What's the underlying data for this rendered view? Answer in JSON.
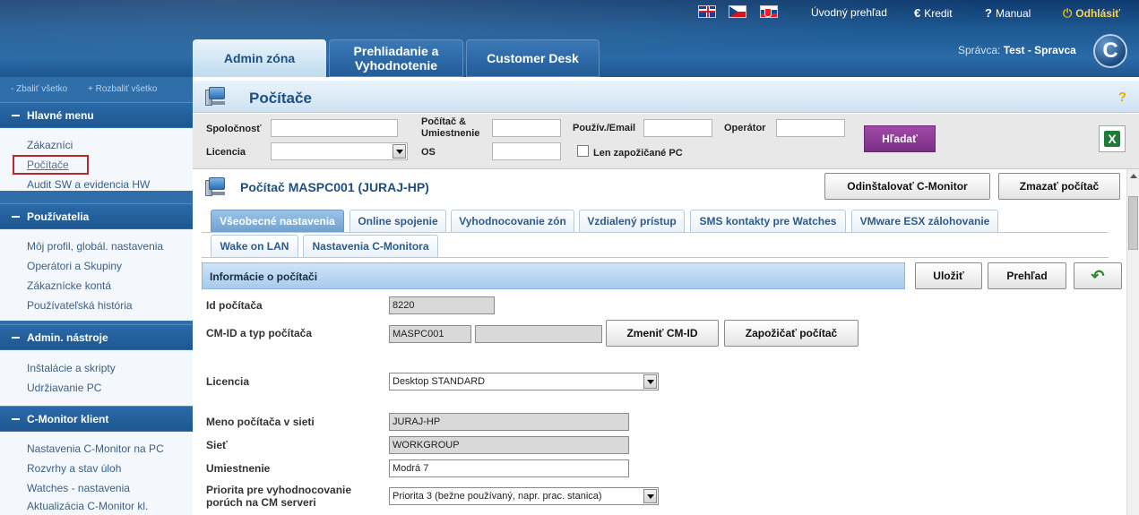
{
  "header": {
    "links": {
      "home": "Úvodný prehľad",
      "credit": "Kredit",
      "manual": "Manual",
      "logout": "Odhlásiť"
    },
    "tabs": {
      "admin": "Admin zóna",
      "browse": "Prehliadanie a Vyhodnotenie",
      "desk": "Customer Desk"
    },
    "admin_prefix": "Správca:",
    "admin_name": "Test - Spravca",
    "logo_letter": "C"
  },
  "sidebar": {
    "collapse_all": "- Zbaliť všetko",
    "expand_all": "+ Rozbaliť všetko",
    "sections": [
      {
        "title": "Hlavné menu",
        "items": [
          "Zákazníci",
          "Počítače",
          "Audit SW a evidencia HW"
        ]
      },
      {
        "title": "Používatelia",
        "items": [
          "Môj profil, globál. nastavenia",
          "Operátori a Skupiny",
          "Zákaznícke kontá",
          "Používateľská história"
        ]
      },
      {
        "title": "Admin. nástroje",
        "items": [
          "Inštalácie a skripty",
          "Udržiavanie PC"
        ]
      },
      {
        "title": "C-Monitor klient",
        "items": [
          "Nastavenia C-Monitor na PC",
          "Rozvrhy a stav úloh",
          "Watches - nastavenia",
          "Aktualizácia C-Monitor kl."
        ]
      }
    ]
  },
  "page": {
    "title": "Počítače",
    "help": "?"
  },
  "filters": {
    "company": "Spoločnosť",
    "license": "Licencia",
    "computer_location": "Počítač & Umiestnenie",
    "os": "OS",
    "user_email": "Použív./Email",
    "operator": "Operátor",
    "borrowed_only": "Len zapožičané PC",
    "search": "Hľadať"
  },
  "computer": {
    "title": "Počítač MASPC001 (JURAJ-HP)",
    "uninstall": "Odinštalovať C-Monitor",
    "delete": "Zmazať počítač",
    "tabs_row1": [
      "Všeobecné nastavenia",
      "Online spojenie",
      "Vyhodnocovanie zón",
      "Vzdialený prístup",
      "SMS kontakty pre Watches",
      "VMware ESX zálohovanie"
    ],
    "tabs_row2": [
      "Wake on LAN",
      "Nastavenia C-Monitora"
    ],
    "section_title": "Informácie o počítači",
    "save": "Uložiť",
    "overview": "Prehľad",
    "fields": {
      "id_label": "Id počítača",
      "id_value": "8220",
      "cmid_label": "CM-ID a typ počítača",
      "cmid_value": "MASPC001",
      "cmid_type": "",
      "change_cmid": "Zmeniť CM-ID",
      "borrow": "Zapožičať počítač",
      "license_label": "Licencia",
      "license_value": "Desktop STANDARD",
      "netname_label": "Meno počítača v sieti",
      "netname_value": "JURAJ-HP",
      "network_label": "Sieť",
      "network_value": "WORKGROUP",
      "location_label": "Umiestnenie",
      "location_value": "Modrá 7",
      "priority_label": "Priorita pre vyhodnocovanie porúch na CM serveri",
      "priority_value": "Priorita 3 (bežne používaný, napr. prac. stanica)"
    }
  }
}
